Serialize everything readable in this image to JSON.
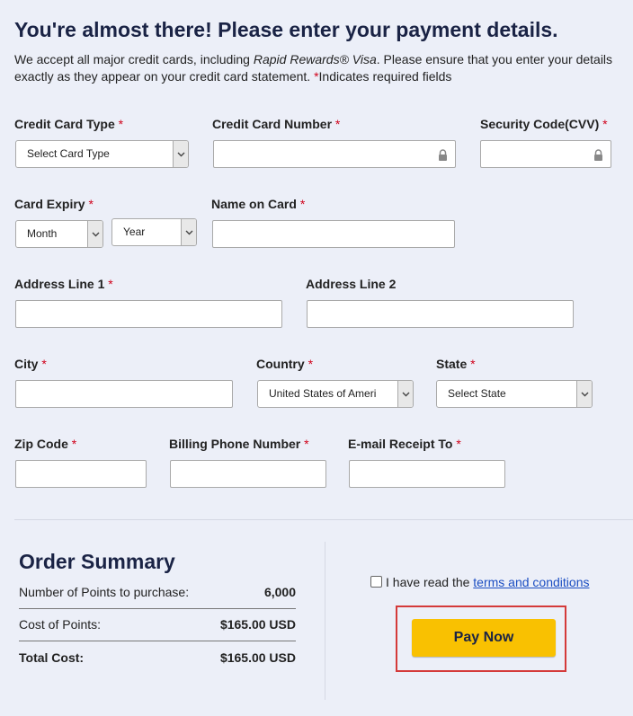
{
  "header": {
    "title": "You're almost there! Please enter your payment details.",
    "intro_prefix": "We accept all major credit cards, including ",
    "intro_brand": "Rapid Rewards® Visa",
    "intro_middle": ". Please ensure that you enter your details exactly as they appear on your credit card statement. ",
    "intro_req_star": "*",
    "intro_suffix": "Indicates required fields"
  },
  "required_marker": "*",
  "form": {
    "card_type": {
      "label": "Credit Card Type",
      "value": "Select Card Type"
    },
    "card_number": {
      "label": "Credit Card Number",
      "value": ""
    },
    "security_code": {
      "label": "Security Code(CVV)",
      "value": ""
    },
    "card_expiry": {
      "label": "Card Expiry",
      "month": "Month",
      "year": "Year"
    },
    "name_on_card": {
      "label": "Name on Card",
      "value": ""
    },
    "address_1": {
      "label": "Address Line 1",
      "value": ""
    },
    "address_2": {
      "label": "Address Line 2",
      "value": ""
    },
    "city": {
      "label": "City",
      "value": ""
    },
    "country": {
      "label": "Country",
      "value": "United States of Ameri"
    },
    "state": {
      "label": "State",
      "value": "Select State"
    },
    "zip": {
      "label": "Zip Code",
      "value": ""
    },
    "phone": {
      "label": "Billing Phone Number",
      "value": ""
    },
    "email": {
      "label": "E-mail Receipt To",
      "value": ""
    }
  },
  "summary": {
    "title": "Order Summary",
    "rows": [
      {
        "label": "Number of Points to purchase:",
        "value": "6,000"
      },
      {
        "label": "Cost of Points:",
        "value": "$165.00 USD"
      },
      {
        "label": "Total Cost:",
        "value": "$165.00 USD"
      }
    ]
  },
  "terms": {
    "checked": false,
    "prefix": "I have read the ",
    "link": "terms and conditions"
  },
  "pay_button": "Pay Now",
  "colors": {
    "background": "#eceff8",
    "title": "#1a2345",
    "required": "#d0021b",
    "link": "#1a4dc2",
    "pay_button": "#f9c101",
    "highlight": "#d43a3a"
  }
}
